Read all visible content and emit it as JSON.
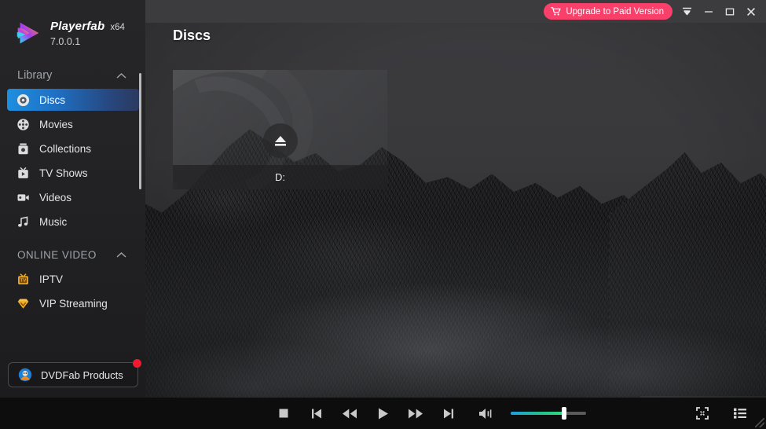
{
  "app": {
    "brand_name": "Playerfab",
    "architecture": "x64",
    "version": "7.0.0.1",
    "logo_icon": "playerfab-logo-icon"
  },
  "titlebar": {
    "upgrade_label": "Upgrade to Paid Version",
    "upgrade_icon": "shopping-cart-icon",
    "upgrade_color": "#f8406a",
    "menu_icon": "menu-caret-icon",
    "minimize_icon": "minimize-icon",
    "maximize_icon": "maximize-icon",
    "close_icon": "close-icon"
  },
  "sidebar": {
    "sections": [
      {
        "title": "Library",
        "collapse_icon": "chevron-up-icon",
        "items": [
          {
            "label": "Discs",
            "icon": "disc-icon",
            "active": true
          },
          {
            "label": "Movies",
            "icon": "film-reel-icon",
            "active": false
          },
          {
            "label": "Collections",
            "icon": "collections-icon",
            "active": false
          },
          {
            "label": "TV Shows",
            "icon": "tv-icon",
            "active": false
          },
          {
            "label": "Videos",
            "icon": "video-camera-icon",
            "active": false
          },
          {
            "label": "Music",
            "icon": "music-note-icon",
            "active": false
          }
        ]
      },
      {
        "title": "ONLINE VIDEO",
        "collapse_icon": "chevron-up-icon",
        "items": [
          {
            "label": "IPTV",
            "icon": "iptv-tv-icon",
            "active": false
          },
          {
            "label": "VIP Streaming",
            "icon": "vip-diamond-icon",
            "active": false
          }
        ]
      }
    ],
    "products_button": {
      "label": "DVDFab Products",
      "icon": "dvdfab-icon",
      "badge_color": "#f2192f"
    },
    "active_highlight_color": "#1e8fe0"
  },
  "main": {
    "page_title": "Discs",
    "discs": [
      {
        "drive_label": "D:",
        "eject_icon": "eject-icon"
      }
    ]
  },
  "player": {
    "controls": [
      {
        "name": "stop-button",
        "icon": "stop-icon"
      },
      {
        "name": "previous-button",
        "icon": "skip-previous-icon"
      },
      {
        "name": "rewind-button",
        "icon": "rewind-icon"
      },
      {
        "name": "play-button",
        "icon": "play-icon"
      },
      {
        "name": "fast-forward-button",
        "icon": "fast-forward-icon"
      },
      {
        "name": "next-button",
        "icon": "skip-next-icon"
      }
    ],
    "volume_icon": "volume-icon",
    "volume_percent": 71,
    "volume_fill_start": "#1f9fe0",
    "volume_fill_end": "#2fdc7a",
    "fullscreen_icon": "fullscreen-icon",
    "playlist_icon": "playlist-icon"
  }
}
